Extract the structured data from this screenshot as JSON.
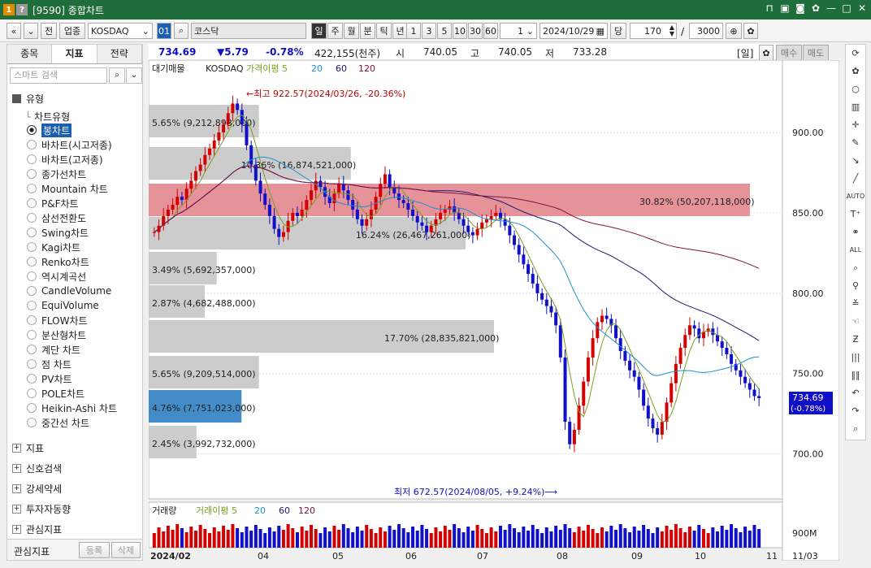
{
  "window": {
    "title": "[9590] 종합차트",
    "badge1": "1",
    "badge2": "?"
  },
  "toolbar": {
    "nav_back": "«",
    "nav_down": "»",
    "prev": "전",
    "sector": "업종",
    "market": "KOSDAQ",
    "code": "01",
    "name": "코스닥",
    "periods": [
      "일",
      "주",
      "월",
      "분",
      "틱",
      "년"
    ],
    "nums": [
      "1",
      "3",
      "5",
      "10",
      "30",
      "60"
    ],
    "count_combo": "1",
    "date": "2024/10/29",
    "unit_label": "당",
    "bars": "170",
    "slash": "/",
    "total": "3000"
  },
  "sidebar": {
    "tabs": [
      "종목",
      "지표",
      "전략"
    ],
    "search_placeholder": "스마트 검색",
    "group": "유형",
    "chart_type": "차트유형",
    "types": [
      "봉차트",
      "바차트(시고저종)",
      "바차트(고저종)",
      "종가선차트",
      "Mountain 차트",
      "P&F차트",
      "삼선전환도",
      "Swing차트",
      "Kagi차트",
      "Renko차트",
      "역시계곡선",
      "CandleVolume",
      "EquiVolume",
      "FLOW차트",
      "분산형차트",
      "계단 차트",
      "점 차트",
      "PV차트",
      "POLE차트",
      "Heikin-Ashi 차트",
      "중간선 차트"
    ],
    "folders": [
      "지표",
      "신호검색",
      "강세약세",
      "투자자동향",
      "관심지표"
    ],
    "footer_label": "관심지표",
    "footer_reg": "등록",
    "footer_del": "삭제"
  },
  "quote": {
    "price": "734.69",
    "change": "▼5.79",
    "pct": "-0.78%",
    "volume": "422,155(천주)",
    "open_label": "시",
    "open": "740.05",
    "high_label": "고",
    "high": "740.05",
    "low_label": "저",
    "low": "733.28",
    "period_label": "[일]",
    "buy": "매수",
    "sell": "매도"
  },
  "legend": {
    "vp": "대기매물",
    "sym": "KOSDAQ",
    "ma_label": "가격이평 5",
    "ma20": "20",
    "ma60": "60",
    "ma120": "120"
  },
  "colors": {
    "up": "#d40000",
    "down": "#1010c8",
    "ma5": "#7aa020",
    "ma20": "#1e90d0",
    "ma60": "#1a1a70",
    "ma120": "#801040"
  },
  "chart_data": {
    "type": "candlestick",
    "y_ticks": [
      "900.00",
      "850.00",
      "800.00",
      "750.00",
      "700.00"
    ],
    "y_tick_values": [
      900,
      850,
      800,
      750,
      700
    ],
    "ylim": [
      672,
      945
    ],
    "x_labels": [
      "2024/02",
      "04",
      "05",
      "06",
      "07",
      "08",
      "09",
      "10",
      "11"
    ],
    "close_series": [
      838,
      842,
      848,
      852,
      855,
      860,
      858,
      865,
      870,
      876,
      880,
      886,
      890,
      895,
      900,
      905,
      912,
      918,
      914,
      905,
      892,
      880,
      870,
      862,
      855,
      848,
      840,
      835,
      838,
      845,
      850,
      848,
      852,
      858,
      864,
      870,
      866,
      860,
      856,
      862,
      868,
      864,
      858,
      852,
      846,
      842,
      846,
      852,
      860,
      868,
      874,
      866,
      862,
      858,
      856,
      852,
      848,
      844,
      842,
      838,
      842,
      846,
      850,
      852,
      854,
      850,
      846,
      842,
      838,
      836,
      840,
      844,
      846,
      848,
      850,
      846,
      842,
      836,
      830,
      824,
      818,
      812,
      806,
      800,
      796,
      792,
      788,
      780,
      760,
      720,
      706,
      715,
      730,
      745,
      760,
      772,
      782,
      786,
      784,
      780,
      772,
      764,
      758,
      752,
      748,
      740,
      730,
      722,
      716,
      712,
      720,
      732,
      744,
      756,
      766,
      774,
      780,
      778,
      772,
      776,
      778,
      774,
      770,
      766,
      762,
      756,
      752,
      748,
      744,
      740,
      736,
      734.69
    ],
    "volume_ticks": [
      "900M"
    ],
    "date_label": "11/03",
    "volume_profile": [
      {
        "label": "5.65% (9,212,898,000)",
        "pct": 5.65
      },
      {
        "label": "10.36% (16,874,521,000)",
        "pct": 10.36
      },
      {
        "label": "30.82% (50,207,118,000)",
        "pct": 30.82
      },
      {
        "label": "16.24% (26,467,261,000)",
        "pct": 16.24
      },
      {
        "label": "3.49% (5,692,357,000)",
        "pct": 3.49
      },
      {
        "label": "2.87% (4,682,488,000)",
        "pct": 2.87
      },
      {
        "label": "17.70% (28,835,821,000)",
        "pct": 17.7
      },
      {
        "label": "5.65% (9,209,514,000)",
        "pct": 5.65
      },
      {
        "label": "4.76% (7,751,023,000)",
        "pct": 4.76
      },
      {
        "label": "2.45% (3,992,732,000)",
        "pct": 2.45
      }
    ],
    "annotations": {
      "high": "←최고 922.57(2024/03/26, -20.36%)",
      "low": "최저 672.57(2024/08/05, +9.24%)⟶"
    },
    "last_label": "734.69",
    "last_pct": "(-0.78%)",
    "volume_legend": [
      "거래량",
      "거래이평 5",
      "20",
      "60",
      "120"
    ]
  }
}
